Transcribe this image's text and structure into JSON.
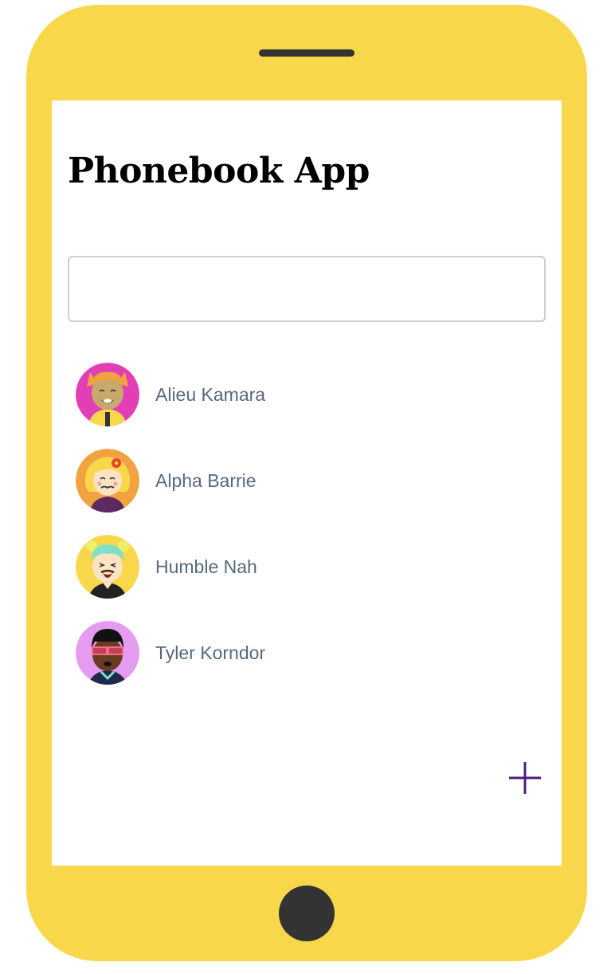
{
  "app": {
    "title": "Phonebook App"
  },
  "search": {
    "value": "",
    "placeholder": ""
  },
  "contacts": [
    {
      "name": "Alieu Kamara",
      "avatar_icon": "avatar-cat-ears-icon",
      "avatar_bg": "#e23fb7"
    },
    {
      "name": "Alpha Barrie",
      "avatar_icon": "avatar-flower-hair-icon",
      "avatar_bg": "#f0a33f"
    },
    {
      "name": "Humble Nah",
      "avatar_icon": "avatar-bun-hair-icon",
      "avatar_bg": "#f8d74a"
    },
    {
      "name": "Tyler Korndor",
      "avatar_icon": "avatar-sunglasses-icon",
      "avatar_bg": "#e59cf0"
    }
  ],
  "actions": {
    "add_icon": "plus-icon"
  },
  "colors": {
    "phone_frame": "#f8d74a",
    "accent": "#4a1f7a",
    "contact_name": "#56697d"
  }
}
